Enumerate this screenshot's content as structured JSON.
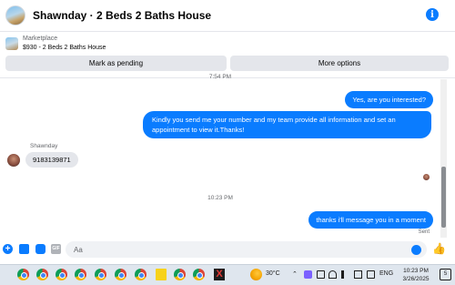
{
  "header": {
    "title": "Shawnday · 2 Beds 2 Baths House",
    "info_icon": "i"
  },
  "marketplace": {
    "label": "Marketplace",
    "listing": "$930 - 2 Beds 2 Baths House",
    "buttons": {
      "mark_pending": "Mark as pending",
      "more_options": "More options"
    }
  },
  "chat": {
    "messages": [
      {
        "from": "me",
        "text": "Yes, are you interested?"
      },
      {
        "from": "me",
        "text": "Kindly you send me your number and my team provide all information and set an appointment to view it.Thanks!"
      },
      {
        "from": "Shawnday",
        "text": "9183139871"
      },
      {
        "from": "me",
        "text": "thanks i'll message you in a moment"
      }
    ],
    "sender_name": "Shawnday",
    "timestamp_mid": "10:23 PM",
    "timestamp_top_partial": "7:54 PM",
    "status": "Sent"
  },
  "composer": {
    "placeholder": "Aa",
    "plus_icon": "+",
    "gif_label": "GIF"
  },
  "taskbar": {
    "weather": "30°C",
    "language": "ENG",
    "time": "10:23 PM",
    "date": "3/26/2025",
    "notification_count": "5"
  },
  "colors": {
    "messenger_blue": "#0a7cff",
    "incoming_bubble": "#e4e6eb"
  }
}
